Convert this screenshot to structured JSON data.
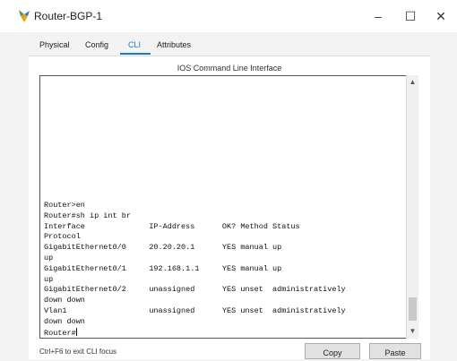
{
  "window": {
    "title": "Router-BGP-1",
    "minimize_glyph": "–",
    "maximize_glyph": "☐",
    "close_glyph": "✕"
  },
  "tabs": [
    {
      "label": "Physical"
    },
    {
      "label": "Config"
    },
    {
      "label": "CLI"
    },
    {
      "label": "Attributes"
    }
  ],
  "active_tab": "CLI",
  "panel": {
    "title": "IOS Command Line Interface"
  },
  "terminal": {
    "lines": [
      "Router>en",
      "Router#sh ip int br",
      "Interface              IP-Address      OK? Method Status",
      "Protocol",
      "GigabitEthernet0/0     20.20.20.1      YES manual up",
      "up",
      "GigabitEthernet0/1     192.168.1.1     YES manual up",
      "up",
      "GigabitEthernet0/2     unassigned      YES unset  administratively",
      "down down",
      "Vlan1                  unassigned      YES unset  administratively",
      "down down",
      "Router#"
    ]
  },
  "footer": {
    "hint": "Ctrl+F6 to exit CLI focus",
    "copy_label": "Copy",
    "paste_label": "Paste"
  },
  "colors": {
    "accent": "#1a7bd0"
  }
}
